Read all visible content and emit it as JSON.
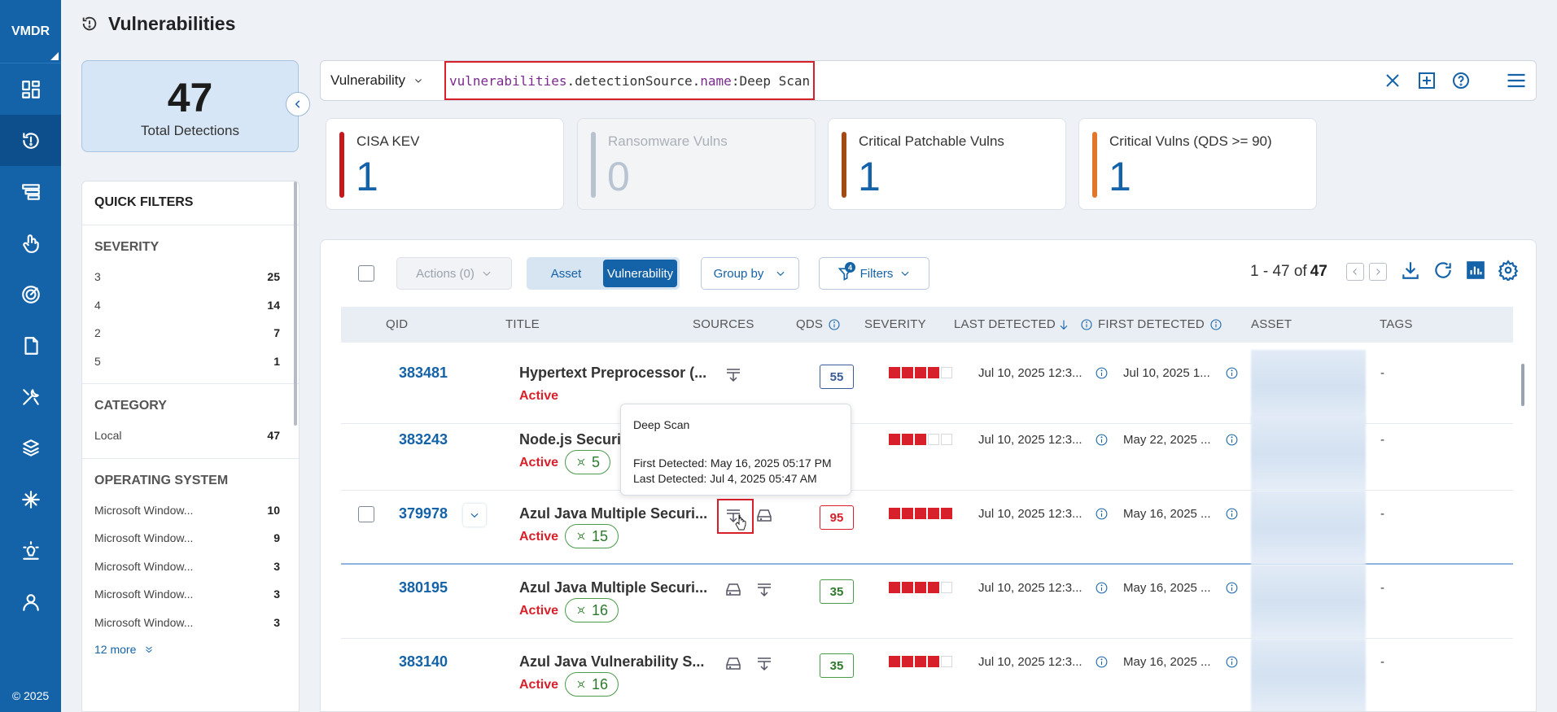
{
  "nav": {
    "brand": "VMDR",
    "copyright": "© 2025",
    "items": [
      "dashboard-icon",
      "vulnerabilities-icon",
      "prioritization-icon",
      "responses-icon",
      "scans-icon",
      "reports-icon",
      "tools-icon",
      "assets-icon",
      "configuration-icon",
      "knowledgebase-icon",
      "users-icon"
    ]
  },
  "header": {
    "title": "Vulnerabilities"
  },
  "summary": {
    "total": "47",
    "total_label": "Total Detections"
  },
  "quick_filters": {
    "title": "QUICK FILTERS",
    "severity": {
      "title": "SEVERITY",
      "items": [
        {
          "label": "3",
          "count": "25"
        },
        {
          "label": "4",
          "count": "14"
        },
        {
          "label": "2",
          "count": "7"
        },
        {
          "label": "5",
          "count": "1"
        }
      ]
    },
    "category": {
      "title": "CATEGORY",
      "items": [
        {
          "label": "Local",
          "count": "47"
        }
      ]
    },
    "os": {
      "title": "OPERATING SYSTEM",
      "items": [
        {
          "label": "Microsoft Window...",
          "count": "10"
        },
        {
          "label": "Microsoft Window...",
          "count": "9"
        },
        {
          "label": "Microsoft Window...",
          "count": "3"
        },
        {
          "label": "Microsoft Window...",
          "count": "3"
        },
        {
          "label": "Microsoft Window...",
          "count": "3"
        }
      ],
      "more": "12 more"
    }
  },
  "search": {
    "scope": "Vulnerability",
    "query_obj": "vulnerabilities",
    "query_dot1": ".",
    "query_mid": "detectionSource",
    "query_dot2": ".",
    "query_key": "name",
    "query_rest": ":Deep Scan"
  },
  "stats": [
    {
      "label": "CISA KEV",
      "value": "1",
      "color": "#c8161d"
    },
    {
      "label": "Ransomware Vulns",
      "value": "0",
      "color": "#b8c3cf"
    },
    {
      "label": "Critical Patchable Vulns",
      "value": "1",
      "color": "#a34a14"
    },
    {
      "label": "Critical Vulns (QDS >= 90)",
      "value": "1",
      "color": "#e2772b"
    }
  ],
  "toolbar": {
    "actions": "Actions (0)",
    "seg_asset": "Asset",
    "seg_vuln": "Vulnerability",
    "group_by": "Group by",
    "filters": "Filters",
    "filters_badge": "4",
    "pager_range": "1 - 47 of",
    "pager_total": "47"
  },
  "columns": {
    "qid": "QID",
    "title": "TITLE",
    "sources": "SOURCES",
    "qds": "QDS",
    "severity": "SEVERITY",
    "last": "LAST DETECTED",
    "first": "FIRST DETECTED",
    "asset": "ASSET",
    "tags": "TAGS"
  },
  "rows": [
    {
      "qid": "383481",
      "title": "Hypertext Preprocessor (...",
      "status": "Active",
      "threat": "",
      "qds": "55",
      "sev": 4,
      "last": "Jul 10, 2025 12:3...",
      "first": "Jul 10, 2025 1...",
      "tags": "-"
    },
    {
      "qid": "383243",
      "title": "Node.js Securit",
      "status": "Active",
      "threat": "5",
      "qds": "",
      "sev": 3,
      "last": "Jul 10, 2025 12:3...",
      "first": "May 22, 2025 ...",
      "tags": "-"
    },
    {
      "qid": "379978",
      "title": "Azul Java Multiple Securi...",
      "status": "Active",
      "threat": "15",
      "qds": "95",
      "sev": 5,
      "last": "Jul 10, 2025 12:3...",
      "first": "May 16, 2025 ...",
      "tags": "-"
    },
    {
      "qid": "380195",
      "title": "Azul Java Multiple Securi...",
      "status": "Active",
      "threat": "16",
      "qds": "35",
      "sev": 4,
      "last": "Jul 10, 2025 12:3...",
      "first": "May 16, 2025 ...",
      "tags": "-"
    },
    {
      "qid": "383140",
      "title": "Azul Java Vulnerability S...",
      "status": "Active",
      "threat": "16",
      "qds": "35",
      "sev": 4,
      "last": "Jul 10, 2025 12:3...",
      "first": "May 16, 2025 ...",
      "tags": "-"
    }
  ],
  "tooltip": {
    "title": "Deep Scan",
    "first": "First Detected: May 16, 2025 05:17 PM",
    "last": "Last Detected: Jul 4, 2025 05:47 AM"
  }
}
